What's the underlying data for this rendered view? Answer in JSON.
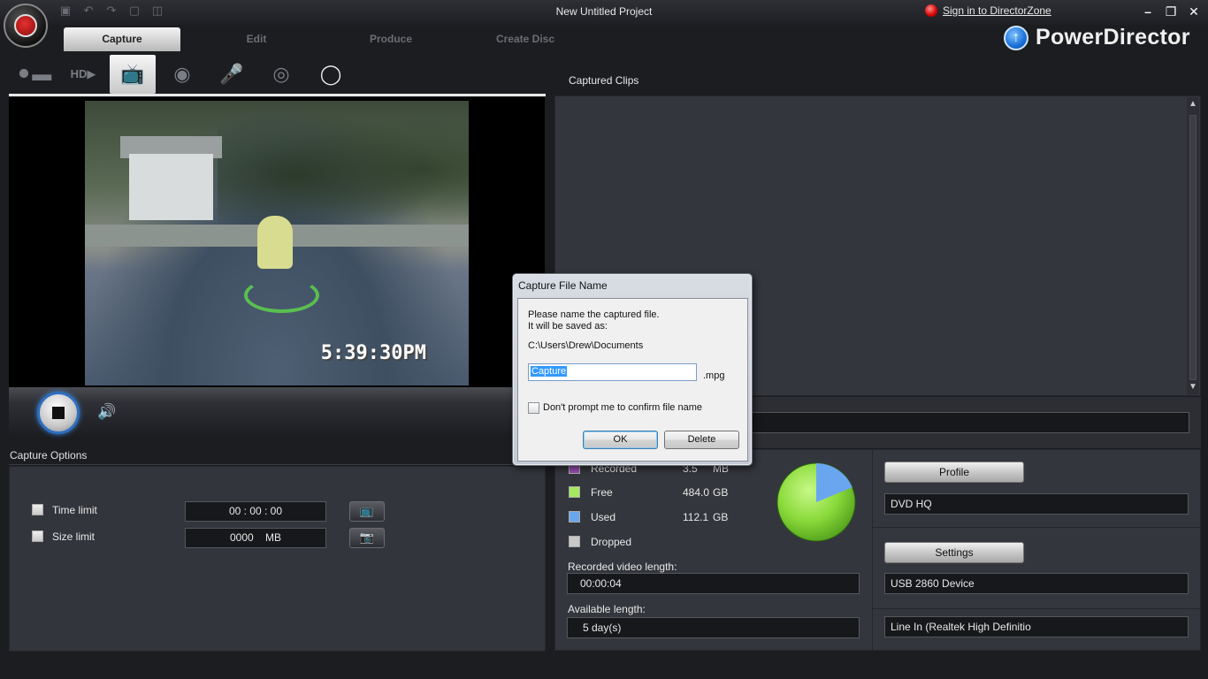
{
  "window": {
    "project_title": "New Untitled Project",
    "signin_label": "Sign in to DirectorZone",
    "brand": "PowerDirector"
  },
  "tabs": [
    {
      "label": "Capture",
      "active": true
    },
    {
      "label": "Edit",
      "active": false
    },
    {
      "label": "Produce",
      "active": false
    },
    {
      "label": "Create Disc",
      "active": false
    }
  ],
  "capture_devices": [
    {
      "icon": "camcorder-icon"
    },
    {
      "icon": "hd-camcorder-icon"
    },
    {
      "icon": "tv-capture-icon",
      "active": true
    },
    {
      "icon": "webcam-icon"
    },
    {
      "icon": "microphone-icon"
    },
    {
      "icon": "cd-audio-icon"
    },
    {
      "icon": "dvd-icon"
    }
  ],
  "preview": {
    "timestamp": "5:39:30PM"
  },
  "capture_options": {
    "header": "Capture Options",
    "time_limit_label": "Time limit",
    "time_limit_value": "00 : 00 : 00",
    "size_limit_label": "Size limit",
    "size_limit_value": "0000    MB"
  },
  "clips": {
    "header": "Captured Clips",
    "save_path": "C:\\Users\\Drew\\Documents\\"
  },
  "stats": {
    "legend": [
      {
        "label": "Recorded",
        "value": "3.5",
        "unit": "MB",
        "color": "#9a4fb0"
      },
      {
        "label": "Free",
        "value": "484.0",
        "unit": "GB",
        "color": "#a6e860"
      },
      {
        "label": "Used",
        "value": "112.1",
        "unit": "GB",
        "color": "#6aa6f0"
      },
      {
        "label": "Dropped",
        "value": "",
        "unit": "",
        "color": "#c8c8c8"
      }
    ],
    "recorded_length_label": "Recorded video length:",
    "recorded_length_value": "00:00:04",
    "available_length_label": "Available length:",
    "available_length_value": "5 day(s)",
    "disk_used_fraction": 0.188
  },
  "side": {
    "profile_button": "Profile",
    "profile_value": "DVD HQ",
    "settings_button": "Settings",
    "video_device": "USB 2860 Device",
    "audio_device": "Line In (Realtek High Definitio"
  },
  "dialog": {
    "title": "Capture File Name",
    "line1": "Please name the captured file.",
    "line2": "It will be saved as:",
    "path": "C:\\Users\\Drew\\Documents",
    "filename": "Capture",
    "extension": ".mpg",
    "checkbox_label": "Don't prompt me to confirm file name",
    "ok_label": "OK",
    "delete_label": "Delete"
  }
}
